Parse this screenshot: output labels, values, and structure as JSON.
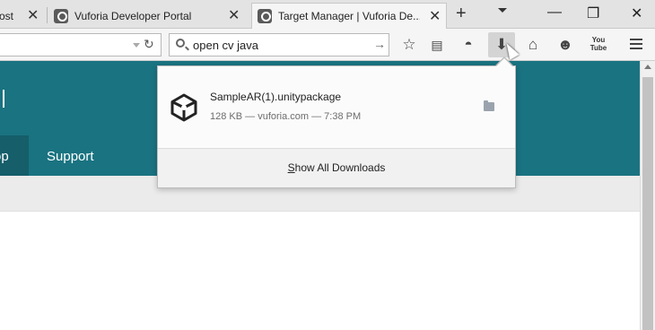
{
  "tabs": [
    {
      "label": "ost"
    },
    {
      "label": "Vuforia Developer Portal"
    },
    {
      "label": "Target Manager | Vuforia De..."
    }
  ],
  "tab_close_glyph": "✕",
  "new_tab_glyph": "+",
  "window": {
    "minimize": "—",
    "restore": "❐",
    "close": "✕"
  },
  "search": {
    "value": "open cv java"
  },
  "toolbar_icons": [
    "star-icon",
    "reading-list-icon",
    "pocket-icon",
    "download-icon",
    "home-icon",
    "smiley-icon",
    "youtube-icon",
    "menu-icon"
  ],
  "youtube_label": "You Tube",
  "page": {
    "nav": {
      "partial_label": "op",
      "support_label": "Support"
    },
    "colors": {
      "banner": "#1a7381",
      "active_nav": "#155e6a"
    }
  },
  "downloads": {
    "items": [
      {
        "filename": "SampleAR(1).unitypackage",
        "meta": "128 KB — vuforia.com — 7:38 PM",
        "icon": "unity-icon"
      }
    ],
    "footer_label_first": "S",
    "footer_label_rest": "how All Downloads"
  }
}
